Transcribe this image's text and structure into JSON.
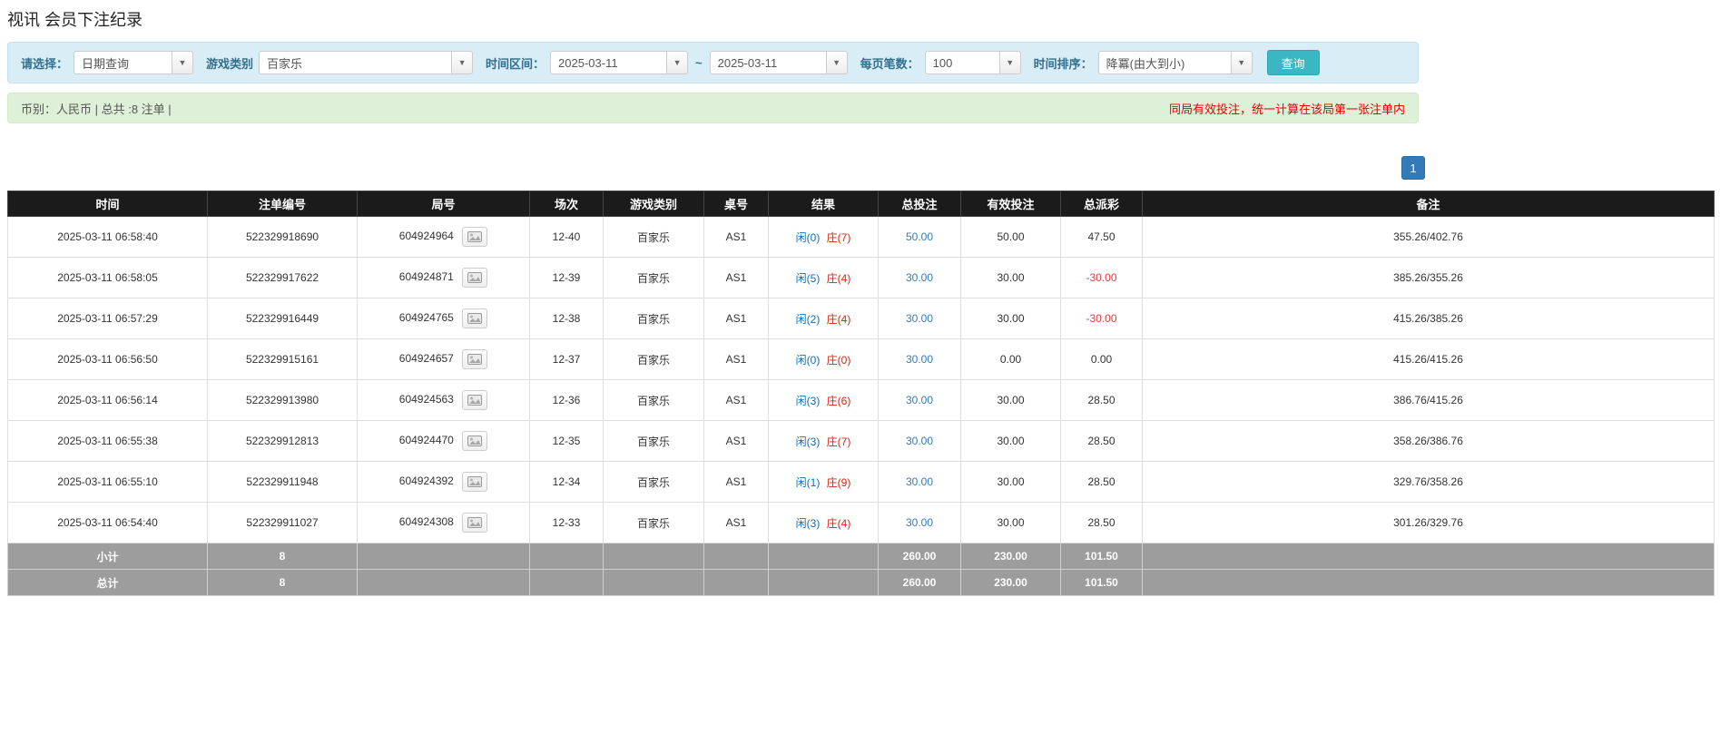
{
  "page": {
    "title": "视讯 会员下注纪录"
  },
  "colors": {
    "accent_button": "#3ab7c3",
    "link_blue": "#337ab7",
    "negative_red": "#e4393c",
    "player_blue": "#0a6ebd",
    "banker_red": "#d9230f",
    "table_header_bg": "#1b1b1b",
    "filter_bar_bg": "#d9edf7",
    "summary_bar_bg": "#dff0d8",
    "note_red": "#e60000"
  },
  "filters": {
    "select_label": "请选择：",
    "select_value": "日期查询",
    "game_type_label": "游戏类别",
    "game_type_value": "百家乐",
    "time_range_label": "时间区间：",
    "time_from": "2025-03-11",
    "range_separator": "~",
    "time_to": "2025-03-11",
    "page_size_label": "每页笔数：",
    "page_size_value": "100",
    "sort_label": "时间排序：",
    "sort_value": "降冪(由大到小)",
    "search_button": "查询"
  },
  "summary": {
    "left": "币别：人民币 | 总共 :8 注单 |",
    "right_note": "同局有效投注，统一计算在该局第一张注单内"
  },
  "pagination": {
    "current": "1"
  },
  "table": {
    "headers": [
      "时间",
      "注单编号",
      "局号",
      "场次",
      "游戏类别",
      "桌号",
      "结果",
      "总投注",
      "有效投注",
      "总派彩",
      "备注"
    ],
    "rows": [
      {
        "time": "2025-03-11 06:58:40",
        "bet_id": "522329918690",
        "round_id": "604924964",
        "session": "12-40",
        "game": "百家乐",
        "table_no": "AS1",
        "result_player": "闲(0)",
        "result_banker": "庄(7)",
        "total_bet": "50.00",
        "valid_bet": "50.00",
        "payout": "47.50",
        "payout_negative": false,
        "note": "355.26/402.76"
      },
      {
        "time": "2025-03-11 06:58:05",
        "bet_id": "522329917622",
        "round_id": "604924871",
        "session": "12-39",
        "game": "百家乐",
        "table_no": "AS1",
        "result_player": "闲(5)",
        "result_banker": "庄(4)",
        "total_bet": "30.00",
        "valid_bet": "30.00",
        "payout": "-30.00",
        "payout_negative": true,
        "note": "385.26/355.26"
      },
      {
        "time": "2025-03-11 06:57:29",
        "bet_id": "522329916449",
        "round_id": "604924765",
        "session": "12-38",
        "game": "百家乐",
        "table_no": "AS1",
        "result_player": "闲(2)",
        "result_banker": "庄(4)",
        "total_bet": "30.00",
        "valid_bet": "30.00",
        "payout": "-30.00",
        "payout_negative": true,
        "note": "415.26/385.26"
      },
      {
        "time": "2025-03-11 06:56:50",
        "bet_id": "522329915161",
        "round_id": "604924657",
        "session": "12-37",
        "game": "百家乐",
        "table_no": "AS1",
        "result_player": "闲(0)",
        "result_banker": "庄(0)",
        "total_bet": "30.00",
        "valid_bet": "0.00",
        "payout": "0.00",
        "payout_negative": false,
        "note": "415.26/415.26"
      },
      {
        "time": "2025-03-11 06:56:14",
        "bet_id": "522329913980",
        "round_id": "604924563",
        "session": "12-36",
        "game": "百家乐",
        "table_no": "AS1",
        "result_player": "闲(3)",
        "result_banker": "庄(6)",
        "total_bet": "30.00",
        "valid_bet": "30.00",
        "payout": "28.50",
        "payout_negative": false,
        "note": "386.76/415.26"
      },
      {
        "time": "2025-03-11 06:55:38",
        "bet_id": "522329912813",
        "round_id": "604924470",
        "session": "12-35",
        "game": "百家乐",
        "table_no": "AS1",
        "result_player": "闲(3)",
        "result_banker": "庄(7)",
        "total_bet": "30.00",
        "valid_bet": "30.00",
        "payout": "28.50",
        "payout_negative": false,
        "note": "358.26/386.76"
      },
      {
        "time": "2025-03-11 06:55:10",
        "bet_id": "522329911948",
        "round_id": "604924392",
        "session": "12-34",
        "game": "百家乐",
        "table_no": "AS1",
        "result_player": "闲(1)",
        "result_banker": "庄(9)",
        "total_bet": "30.00",
        "valid_bet": "30.00",
        "payout": "28.50",
        "payout_negative": false,
        "note": "329.76/358.26"
      },
      {
        "time": "2025-03-11 06:54:40",
        "bet_id": "522329911027",
        "round_id": "604924308",
        "session": "12-33",
        "game": "百家乐",
        "table_no": "AS1",
        "result_player": "闲(3)",
        "result_banker": "庄(4)",
        "total_bet": "30.00",
        "valid_bet": "30.00",
        "payout": "28.50",
        "payout_negative": false,
        "note": "301.26/329.76"
      }
    ],
    "subtotal": {
      "label": "小计",
      "count": "8",
      "total_bet": "260.00",
      "valid_bet": "230.00",
      "payout": "101.50"
    },
    "total": {
      "label": "总计",
      "count": "8",
      "total_bet": "260.00",
      "valid_bet": "230.00",
      "payout": "101.50"
    }
  }
}
